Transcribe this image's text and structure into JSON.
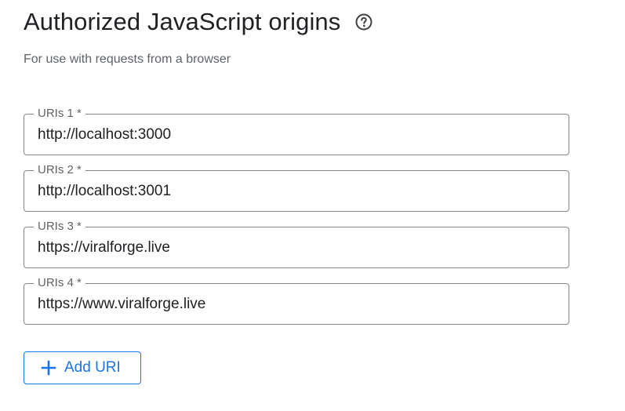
{
  "header": {
    "title": "Authorized JavaScript origins",
    "help_icon": "help-circle-icon",
    "subtitle": "For use with requests from a browser"
  },
  "uris": [
    {
      "label": "URIs 1 *",
      "value": "http://localhost:3000"
    },
    {
      "label": "URIs 2 *",
      "value": "http://localhost:3001"
    },
    {
      "label": "URIs 3 *",
      "value": "https://viralforge.live"
    },
    {
      "label": "URIs 4 *",
      "value": "https://www.viralforge.live"
    }
  ],
  "add_button": {
    "icon": "plus-icon",
    "label": "Add URI"
  },
  "colors": {
    "accent": "#1a73e8",
    "text": "#202124",
    "secondary_text": "#5f6368",
    "border": "#80868b"
  }
}
